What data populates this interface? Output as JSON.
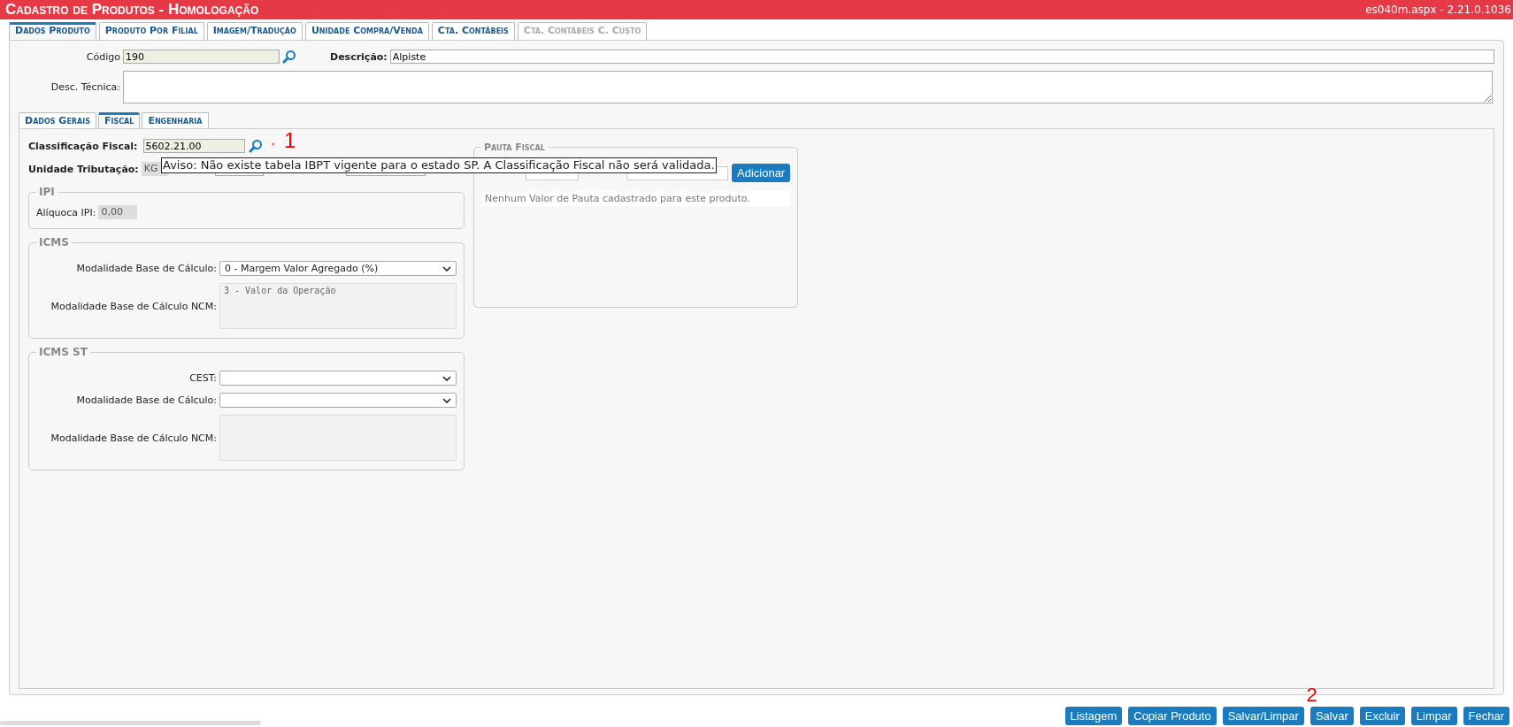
{
  "header": {
    "title": "Cadastro de Produtos  - Homologação",
    "version": "es040m.aspx - 2.21.0.1036"
  },
  "tabs": [
    {
      "label": "Dados Produto",
      "selected": true,
      "disabled": false
    },
    {
      "label": "Produto Por Filial",
      "selected": false,
      "disabled": false
    },
    {
      "label": "Imagem/Tradução",
      "selected": false,
      "disabled": false
    },
    {
      "label": "Unidade Compra/Venda",
      "selected": false,
      "disabled": false
    },
    {
      "label": "Cta. Contábeis",
      "selected": false,
      "disabled": false
    },
    {
      "label": "Cta. Contábeis C. Custo",
      "selected": false,
      "disabled": true
    }
  ],
  "codigo": {
    "label": "Código",
    "value": "190"
  },
  "descricao": {
    "label": "Descrição:",
    "value": "Alpiste"
  },
  "desc_tecnica": {
    "label": "Desc. Técnica:"
  },
  "sub_tabs": [
    {
      "label": "Dados Gerais",
      "selected": false
    },
    {
      "label": "Fiscal",
      "selected": true
    },
    {
      "label": "Engenharia",
      "selected": false
    }
  ],
  "fiscal": {
    "classificacao": {
      "label": "Classificação Fiscal:",
      "value": "5602.21.00",
      "required_mark": "*"
    },
    "annotation": "1",
    "tooltip": "Aviso: Não existe tabela IBPT vigente para o estado SP. A Classificação Fiscal não será validada.",
    "unidade": {
      "label": "Unidade Tributação:",
      "value": "KG"
    }
  },
  "ipi": {
    "legend": "IPI",
    "label": "Alíquoca IPI:",
    "value": "0,00"
  },
  "icms": {
    "legend": "ICMS",
    "modalidade": {
      "label": "Modalidade Base de Cálculo:",
      "value": "0 - Margem Valor Agregado (%)"
    },
    "ncm": {
      "label": "Modalidade Base de Cálculo NCM:",
      "value": "3 - Valor da Operação"
    }
  },
  "icms_st": {
    "legend": "ICMS ST",
    "cest": {
      "label": "CEST:"
    },
    "modalidade": {
      "label": "Modalidade Base de Cálculo:"
    },
    "ncm": {
      "label": "Modalidade Base de Cálculo NCM:"
    }
  },
  "pauta": {
    "legend": "Pauta Fiscal",
    "button": "Adicionar",
    "empty_message": "Nenhum Valor de Pauta cadastrado para este produto."
  },
  "annotation_2": "2",
  "buttons": [
    "Listagem",
    "Copiar Produto",
    "Salvar/Limpar",
    "Salvar",
    "Excluir",
    "Limpar",
    "Fechar"
  ]
}
